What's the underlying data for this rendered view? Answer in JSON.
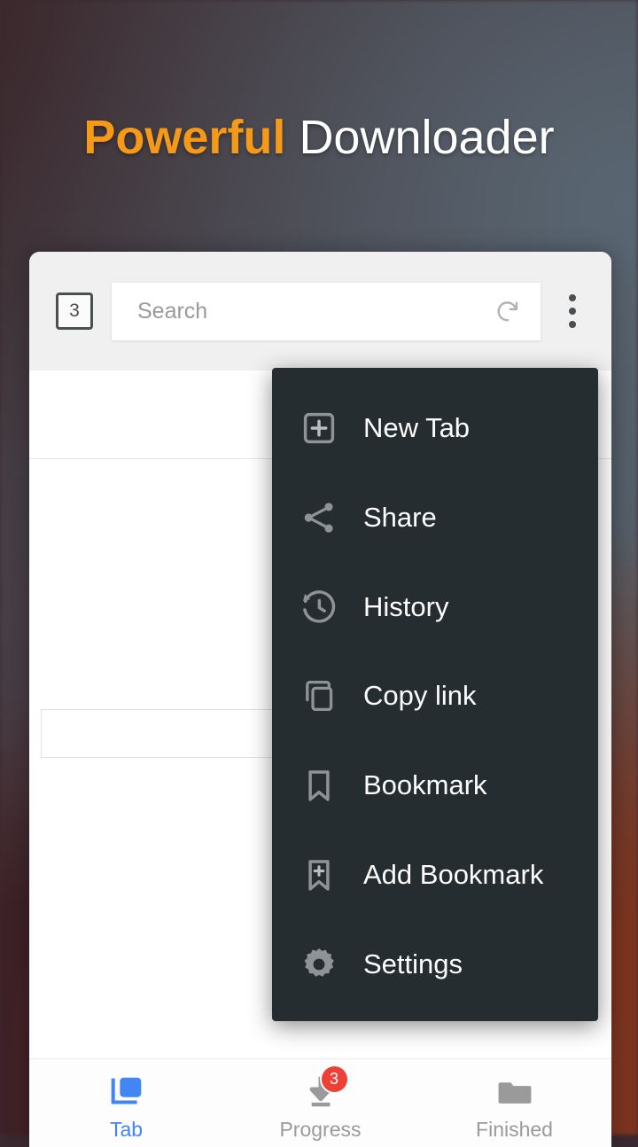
{
  "headline": {
    "accent_word": "Powerful",
    "plain_word": "Downloader",
    "accent_color": "#f59a18",
    "plain_color": "#ffffff"
  },
  "toolbar": {
    "tab_count": "3",
    "search_placeholder": "Search",
    "search_value": "",
    "refresh_icon": "refresh-icon",
    "overflow_icon": "kebab-menu-icon"
  },
  "menu": {
    "background_color": "#262d30",
    "items": [
      {
        "label": "New Tab",
        "icon": "new-tab-icon"
      },
      {
        "label": "Share",
        "icon": "share-icon"
      },
      {
        "label": "History",
        "icon": "history-clock-icon"
      },
      {
        "label": "Copy link",
        "icon": "copy-icon"
      },
      {
        "label": "Bookmark",
        "icon": "bookmark-icon"
      },
      {
        "label": "Add Bookmark",
        "icon": "bookmark-add-icon"
      },
      {
        "label": "Settings",
        "icon": "gear-icon"
      }
    ]
  },
  "bottom_nav": {
    "active_color": "#4285f4",
    "inactive_color": "#9a9a9a",
    "badge_color": "#ee4036",
    "items": [
      {
        "label": "Tab",
        "icon": "tabs-stack-icon",
        "active": true,
        "badge": ""
      },
      {
        "label": "Progress",
        "icon": "download-arrow-icon",
        "active": false,
        "badge": "3"
      },
      {
        "label": "Finished",
        "icon": "folder-icon",
        "active": false,
        "badge": ""
      }
    ]
  }
}
